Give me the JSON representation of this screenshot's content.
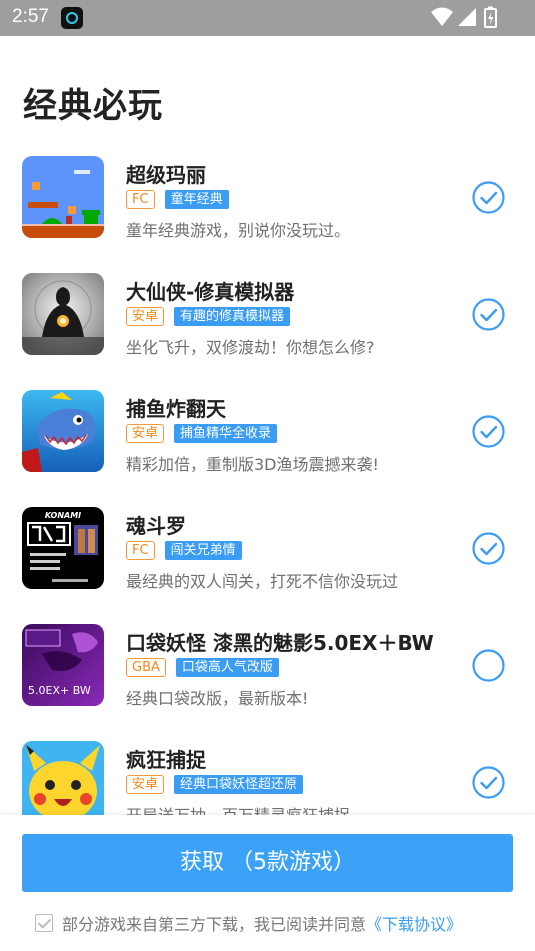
{
  "status_bar": {
    "time": "2:57"
  },
  "page_title": "经典必玩",
  "games": [
    {
      "name": "超级玛丽",
      "platform": "FC",
      "tag": "童年经典",
      "description": "童年经典游戏，别说你没玩过。",
      "selected": true,
      "thumb": "mario"
    },
    {
      "name": "大仙侠-修真模拟器",
      "platform": "安卓",
      "tag": "有趣的修真模拟器",
      "description": "坐化飞升，双修渡劫！你想怎么修?",
      "selected": true,
      "thumb": "xianxia"
    },
    {
      "name": "捕鱼炸翻天",
      "platform": "安卓",
      "tag": "捕鱼精华全收录",
      "description": "精彩加倍，重制版3D渔场震撼来袭!",
      "selected": true,
      "thumb": "fish"
    },
    {
      "name": "魂斗罗",
      "platform": "FC",
      "tag": "闯关兄弟情",
      "description": "最经典的双人闯关，打死不信你没玩过",
      "selected": true,
      "thumb": "contra"
    },
    {
      "name": "口袋妖怪 漆黑的魅影5.0EX＋BW",
      "platform": "GBA",
      "tag": "口袋高人气改版",
      "description": "经典口袋改版，最新版本!",
      "selected": false,
      "thumb": "pokemon"
    },
    {
      "name": "疯狂捕捉",
      "platform": "安卓",
      "tag": "经典口袋妖怪超还原",
      "description": "开局送万抽，百万精灵疯狂捕捉",
      "selected": true,
      "thumb": "pikachu"
    }
  ],
  "thumb_texts": {
    "contra_brand": "KONAMI",
    "pokemon_caption": "5.0EX+ BW"
  },
  "get_button": "获取 （5款游戏）",
  "agreement": {
    "text": "部分游戏来自第三方下载，我已阅读并同意",
    "link": "《下载协议》",
    "checked": true
  },
  "colors": {
    "accent": "#3ca2f8",
    "tag_bg": "#3a9cf2",
    "platform_orange": "#f08a1c",
    "status_bar": "#9e9e9e"
  }
}
